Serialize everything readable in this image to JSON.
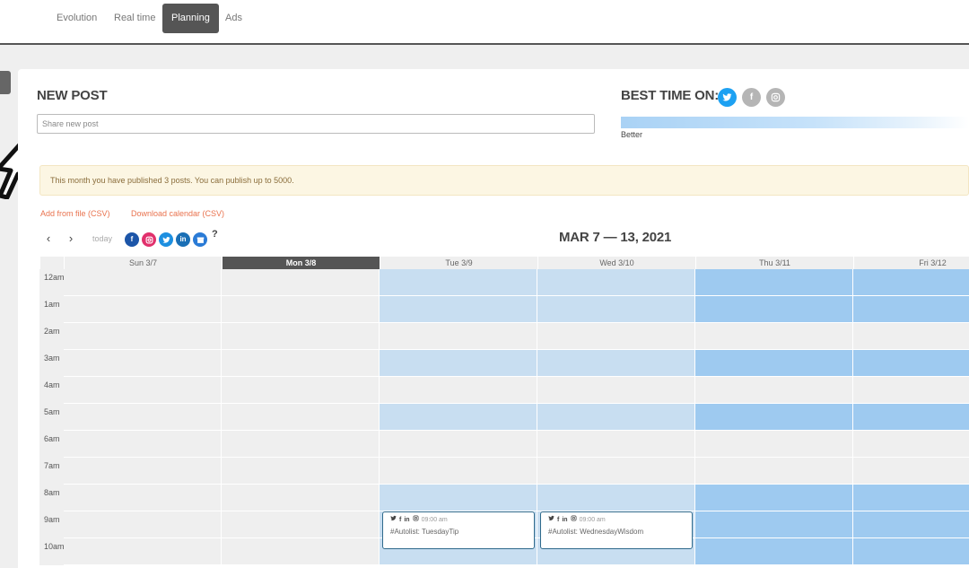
{
  "nav": {
    "tabs": [
      {
        "label": "Evolution",
        "active": false
      },
      {
        "label": "Real time",
        "active": false
      },
      {
        "label": "Planning",
        "active": true
      },
      {
        "label": "Ads",
        "active": false
      }
    ]
  },
  "new_post": {
    "title": "NEW POST",
    "placeholder": "Share new post"
  },
  "best_time": {
    "title": "BEST TIME ON:",
    "networks": [
      "twitter",
      "facebook",
      "instagram"
    ],
    "legend_label": "Better"
  },
  "notice": "This month you have published 3 posts. You can publish up to 5000.",
  "links": {
    "add_from_file": "Add from file (CSV)",
    "download_calendar": "Download calendar (CSV)"
  },
  "toolbar": {
    "prev": "‹",
    "next": "›",
    "today": "today",
    "help": "?",
    "networks": [
      "facebook",
      "instagram",
      "twitter",
      "linkedin",
      "google-my-business"
    ]
  },
  "calendar": {
    "range_title": "MAR 7 — 13, 2021",
    "days": [
      {
        "label": "Sun 3/7",
        "is_today": false
      },
      {
        "label": "Mon 3/8",
        "is_today": true
      },
      {
        "label": "Tue 3/9",
        "is_today": false
      },
      {
        "label": "Wed 3/10",
        "is_today": false
      },
      {
        "label": "Thu 3/11",
        "is_today": false
      },
      {
        "label": "Fri 3/12",
        "is_today": false
      }
    ],
    "hours": [
      "12am",
      "1am",
      "2am",
      "3am",
      "4am",
      "5am",
      "6am",
      "7am",
      "8am",
      "9am",
      "10am"
    ],
    "colors": {
      "empty": "#efefef",
      "medium": "#c8def1",
      "high": "#9ecaf0",
      "today_header": "#555555"
    },
    "best_time_levels": [
      [
        0,
        0,
        1,
        1,
        2,
        2
      ],
      [
        0,
        0,
        1,
        1,
        2,
        2
      ],
      [
        0,
        0,
        0,
        0,
        0,
        0
      ],
      [
        0,
        0,
        1,
        1,
        2,
        2
      ],
      [
        0,
        0,
        0,
        0,
        0,
        0
      ],
      [
        0,
        0,
        1,
        1,
        2,
        2
      ],
      [
        0,
        0,
        0,
        0,
        0,
        0
      ],
      [
        0,
        0,
        0,
        0,
        0,
        0
      ],
      [
        0,
        0,
        1,
        1,
        2,
        2
      ],
      [
        0,
        0,
        1,
        1,
        2,
        2
      ],
      [
        0,
        0,
        1,
        1,
        2,
        2
      ]
    ],
    "events": [
      {
        "day": 2,
        "hour": 9,
        "networks": [
          "twitter",
          "facebook",
          "linkedin",
          "instagram"
        ],
        "time": "09:00 am",
        "text": "#Autolist: TuesdayTip"
      },
      {
        "day": 3,
        "hour": 9,
        "networks": [
          "twitter",
          "facebook",
          "linkedin",
          "instagram"
        ],
        "time": "09:00 am",
        "text": "#Autolist: WednesdayWisdom"
      }
    ]
  }
}
